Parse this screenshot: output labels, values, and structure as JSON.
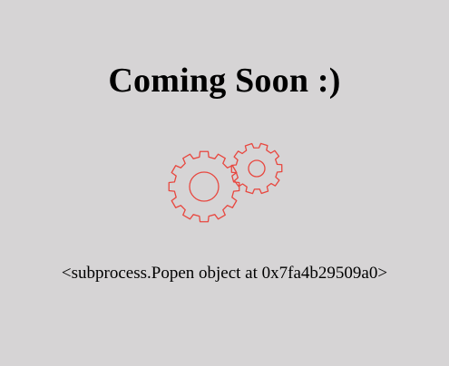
{
  "page": {
    "heading": "Coming Soon :)",
    "status_text": "<subprocess.Popen object at 0x7fa4b29509a0>"
  },
  "illustration": {
    "icon": "gears-icon",
    "color": "#e8473f"
  },
  "colors": {
    "background": "#d6d4d5",
    "text": "#000000"
  }
}
